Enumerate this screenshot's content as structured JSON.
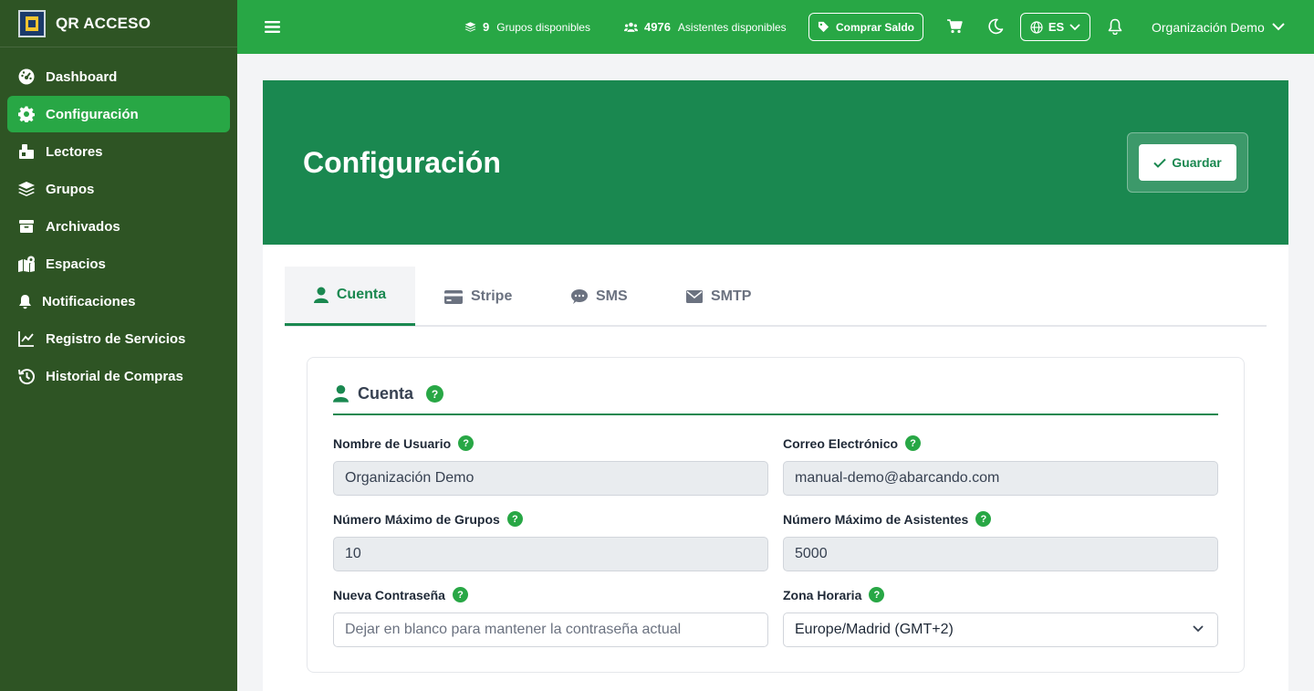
{
  "brand": {
    "name": "QR ACCESO",
    "logo_icon": "qr-logo-icon"
  },
  "sidebar": {
    "items": [
      {
        "label": "Dashboard",
        "icon": "gauge-icon"
      },
      {
        "label": "Configuración",
        "icon": "gear-icon",
        "active": true
      },
      {
        "label": "Lectores",
        "icon": "reader-icon"
      },
      {
        "label": "Grupos",
        "icon": "layers-icon"
      },
      {
        "label": "Archivados",
        "icon": "archive-icon"
      },
      {
        "label": "Espacios",
        "icon": "map-location-icon"
      },
      {
        "label": "Notificaciones",
        "icon": "bell-icon"
      },
      {
        "label": "Registro de Servicios",
        "icon": "chart-line-icon"
      },
      {
        "label": "Historial de Compras",
        "icon": "history-icon"
      }
    ]
  },
  "topbar": {
    "groups_count": "9",
    "groups_label": "Grupos disponibles",
    "attendees_count": "4976",
    "attendees_label": "Asistentes disponibles",
    "buy_label": "Comprar Saldo",
    "language": "ES",
    "organization": "Organización Demo"
  },
  "page": {
    "title": "Configuración",
    "save_label": "Guardar"
  },
  "tabs": [
    {
      "label": "Cuenta",
      "icon": "user-icon",
      "active": true
    },
    {
      "label": "Stripe",
      "icon": "credit-card-icon"
    },
    {
      "label": "SMS",
      "icon": "sms-icon"
    },
    {
      "label": "SMTP",
      "icon": "envelope-icon"
    }
  ],
  "account": {
    "section_title": "Cuenta",
    "help_glyph": "?",
    "username": {
      "label": "Nombre de Usuario",
      "value": "Organización Demo"
    },
    "email": {
      "label": "Correo Electrónico",
      "value": "manual-demo@abarcando.com"
    },
    "max_groups": {
      "label": "Número Máximo de Grupos",
      "value": "10"
    },
    "max_attendees": {
      "label": "Número Máximo de Asistentes",
      "value": "5000"
    },
    "new_password": {
      "label": "Nueva Contraseña",
      "placeholder": "Dejar en blanco para mantener la contraseña actual"
    },
    "timezone": {
      "label": "Zona Horaria",
      "value": "Europe/Madrid (GMT+2)"
    }
  },
  "colors": {
    "sidebar_bg": "#2e5424",
    "accent": "#28a745",
    "hero": "#1a8850"
  }
}
